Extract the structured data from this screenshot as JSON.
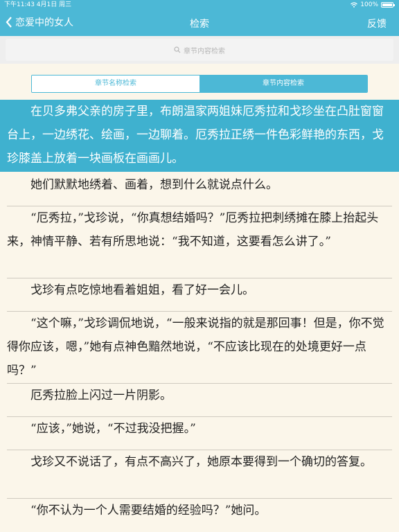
{
  "status": {
    "time_date": "下午11:43  4月1日 周三",
    "battery": "100%"
  },
  "nav": {
    "back_label": "恋爱中的女人",
    "title": "检索",
    "feedback": "反馈"
  },
  "search": {
    "placeholder": "章节内容检索"
  },
  "segment": {
    "tab1": "章节名称检索",
    "tab2": "章节内容检索"
  },
  "paragraphs": [
    "　　在贝多弗父亲的房子里，布朗温家两姐妹厄秀拉和戈珍坐在凸肚窗窗台上，一边绣花、绘画，一边聊着。厄秀拉正绣一件色彩鲜艳的东西，戈珍膝盖上放着一块画板在画画儿。",
    "　　她们默默地绣着、画着，想到什么就说点什么。",
    "　　“厄秀拉，”戈珍说，“你真想结婚吗？”厄秀拉把刺绣摊在膝上抬起头来，神情平静、若有所思地说：“我不知道，这要看怎么讲了。”",
    "　　戈珍有点吃惊地看着姐姐，看了好一会儿。",
    "　　“这个嘛，”戈珍调侃地说，“一般来说指的就是那回事！但是，你不觉得你应该，嗯，”她有点神色黯然地说，“不应该比现在的处境更好一点吗？”",
    "　　厄秀拉脸上闪过一片阴影。",
    "　　“应该，”她说，“不过我没把握。”",
    "　　戈珍又不说话了，有点不高兴了，她原本要得到一个确切的答复。",
    "　　“你不认为一个人需要结婚的经验吗？”她问。"
  ]
}
